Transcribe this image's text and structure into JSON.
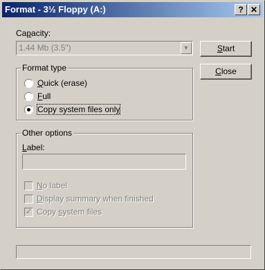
{
  "window": {
    "title": "Format - 3½ Floppy (A:)",
    "help_button": "?",
    "close_button": "✕"
  },
  "capacity": {
    "label_pre": "Ca",
    "label_acc": "p",
    "label_post": "acity:",
    "value": "1.44 Mb (3.5\")",
    "arrow": "▼"
  },
  "buttons": {
    "start_acc": "S",
    "start_rest": "tart",
    "close_acc": "C",
    "close_rest": "lose"
  },
  "format_type": {
    "title": "Format type",
    "options": [
      {
        "acc": "Q",
        "rest": "uick (erase)",
        "selected": false
      },
      {
        "acc": "F",
        "rest": "ull",
        "selected": false
      },
      {
        "pre": "Copy system files onl",
        "acc": "y",
        "selected": true
      }
    ]
  },
  "other_options": {
    "title": "Other options",
    "label_pre": "L",
    "label_rest": "abel:",
    "label_value": "",
    "checkboxes": [
      {
        "acc": "N",
        "rest": "o label",
        "checked": false
      },
      {
        "acc": "D",
        "rest": "isplay summary when finished",
        "checked": false
      },
      {
        "pre": "Copy ",
        "acc": "s",
        "rest": "ystem files",
        "checked": true,
        "mark": "✓"
      }
    ]
  },
  "status_text": ""
}
